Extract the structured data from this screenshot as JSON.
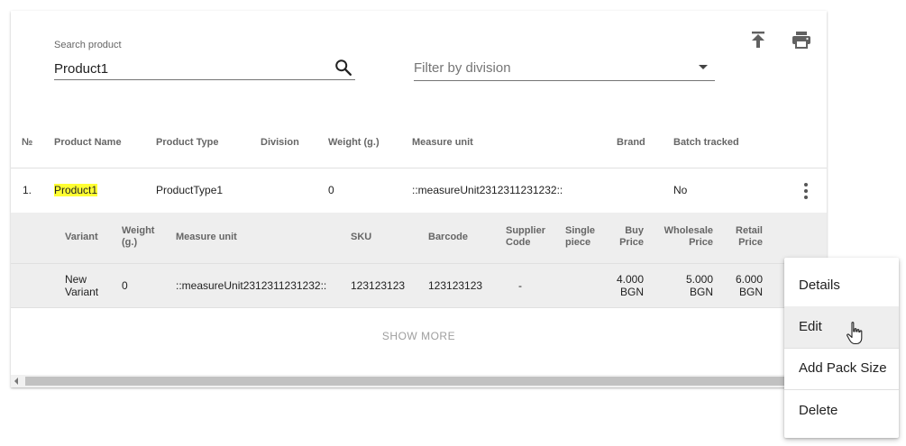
{
  "search": {
    "label": "Search product",
    "value": "Product1"
  },
  "filter": {
    "placeholder": "Filter by division"
  },
  "toolbar": {
    "export_icon": "upload-icon",
    "print_icon": "print-icon"
  },
  "table": {
    "headers": [
      "№",
      "Product Name",
      "Product Type",
      "Division",
      "Weight (g.)",
      "Measure unit",
      "Brand",
      "Batch tracked"
    ],
    "rows": [
      {
        "num": "1.",
        "name": "Product1",
        "type": "ProductType1",
        "division": "",
        "weight": "0",
        "measure_unit": "::measureUnit2312311231232::",
        "brand": "",
        "batch_tracked": "No"
      }
    ]
  },
  "variants": {
    "headers": {
      "variant": "Variant",
      "weight_1": "Weight",
      "weight_2": "(g.)",
      "measure_unit": "Measure unit",
      "sku": "SKU",
      "barcode": "Barcode",
      "supplier_1": "Supplier",
      "supplier_2": "Code",
      "single_1": "Single",
      "single_2": "piece",
      "buy_1": "Buy",
      "buy_2": "Price",
      "wholesale_1": "Wholesale",
      "wholesale_2": "Price",
      "retail_1": "Retail",
      "retail_2": "Price"
    },
    "rows": [
      {
        "variant_1": "New",
        "variant_2": "Variant",
        "weight": "0",
        "measure_unit": "::measureUnit2312311231232::",
        "sku": "123123123",
        "barcode": "123123123",
        "supplier_code": "-",
        "single_piece": "",
        "buy_1": "4.000",
        "buy_2": "BGN",
        "wholesale_1": "5.000",
        "wholesale_2": "BGN",
        "retail_1": "6.000",
        "retail_2": "BGN"
      }
    ]
  },
  "show_more": "SHOW MORE",
  "context_menu": {
    "items": [
      "Details",
      "Edit",
      "Add Pack Size",
      "Delete"
    ],
    "hovered": "Edit"
  }
}
